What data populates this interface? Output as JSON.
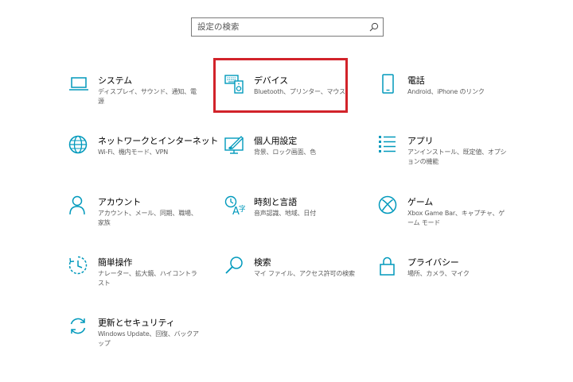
{
  "search": {
    "placeholder": "設定の検索"
  },
  "accent_color": "#0099bc",
  "highlight_color": "#d2232a",
  "settings": [
    {
      "icon": "laptop-icon",
      "title": "システム",
      "desc": "ディスプレイ、サウンド、通知、電源"
    },
    {
      "icon": "keyboard-speaker-icon",
      "title": "デバイス",
      "desc": "Bluetooth、プリンター、マウス"
    },
    {
      "icon": "phone-icon",
      "title": "電話",
      "desc": "Android、iPhone のリンク"
    },
    {
      "icon": "globe-icon",
      "title": "ネットワークとインターネット",
      "desc": "Wi-Fi、機内モード、VPN"
    },
    {
      "icon": "paint-monitor-icon",
      "title": "個人用設定",
      "desc": "背景、ロック画面、色"
    },
    {
      "icon": "apps-list-icon",
      "title": "アプリ",
      "desc": "アンインストール、既定値、オプションの機能"
    },
    {
      "icon": "person-icon",
      "title": "アカウント",
      "desc": "アカウント、メール、同期、職場、家族"
    },
    {
      "icon": "time-language-icon",
      "title": "時刻と言語",
      "desc": "音声認識、地域、日付"
    },
    {
      "icon": "xbox-icon",
      "title": "ゲーム",
      "desc": "Xbox Game Bar、キャプチャ、ゲーム モード"
    },
    {
      "icon": "ease-of-access-icon",
      "title": "簡単操作",
      "desc": "ナレーター、拡大鏡、ハイコントラスト"
    },
    {
      "icon": "search-icon",
      "title": "検索",
      "desc": "マイ ファイル、アクセス許可の検索"
    },
    {
      "icon": "lock-icon",
      "title": "プライバシー",
      "desc": "場所、カメラ、マイク"
    },
    {
      "icon": "sync-icon",
      "title": "更新とセキュリティ",
      "desc": "Windows Update、回復、バックアップ"
    }
  ]
}
